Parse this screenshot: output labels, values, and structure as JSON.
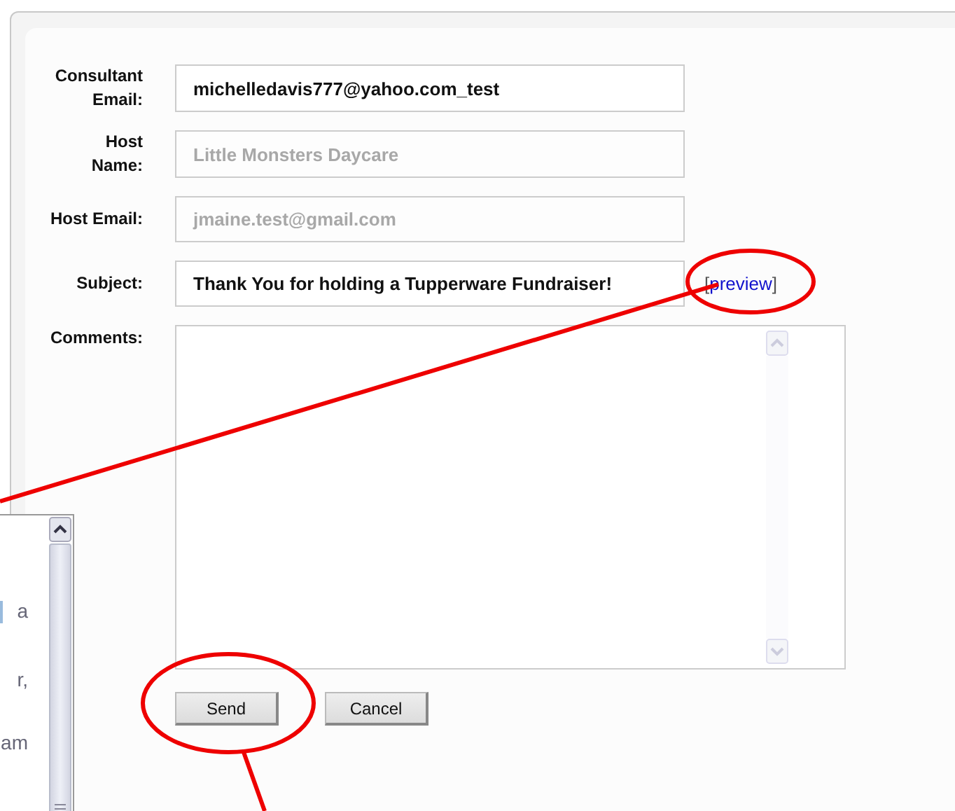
{
  "form": {
    "fields": [
      {
        "label": [
          "Consultant",
          "Email:"
        ],
        "value": "michelledavis777@yahoo.com_test",
        "disabled": false
      },
      {
        "label": [
          "Host",
          "Name:"
        ],
        "value": "Little Monsters Daycare",
        "disabled": true
      },
      {
        "label": [
          "Host Email:"
        ],
        "value": "jmaine.test@gmail.com",
        "disabled": true
      },
      {
        "label": [
          "Subject:"
        ],
        "value": "Thank You for holding a Tupperware Fundraiser!",
        "disabled": false,
        "link": {
          "open": "[",
          "text": "preview",
          "close": "]"
        }
      }
    ],
    "comments": {
      "label": "Comments:"
    },
    "buttons": [
      "Send",
      "Cancel"
    ]
  },
  "popup": {
    "fragments": [
      "a",
      "r,",
      "am"
    ]
  }
}
